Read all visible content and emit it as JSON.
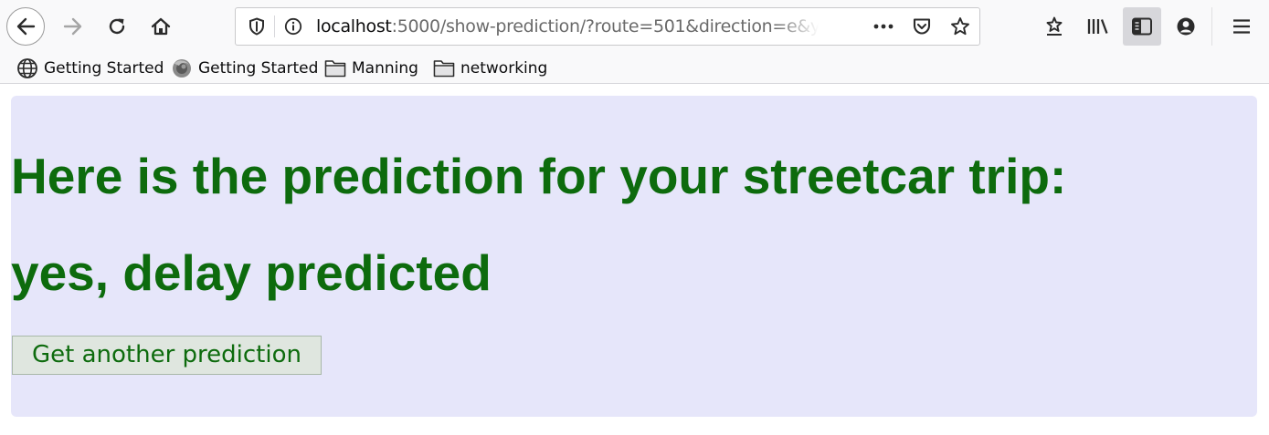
{
  "browser": {
    "url": {
      "host": "localhost",
      "rest": ":5000/show-prediction/?route=501&direction=e&ye"
    },
    "bookmarks": [
      {
        "label": "Getting Started",
        "icon": "globe-icon"
      },
      {
        "label": "Getting Started",
        "icon": "firefox-icon"
      },
      {
        "label": "Manning",
        "icon": "folder-icon"
      },
      {
        "label": "networking",
        "icon": "folder-icon"
      }
    ]
  },
  "page": {
    "title": "Here is the prediction for your streetcar trip:",
    "result": "yes, delay predicted",
    "button_label": "Get another prediction"
  },
  "colors": {
    "text_green": "#0d6b0d",
    "panel_bg": "#e6e6fa",
    "button_bg": "#dfe6df"
  }
}
